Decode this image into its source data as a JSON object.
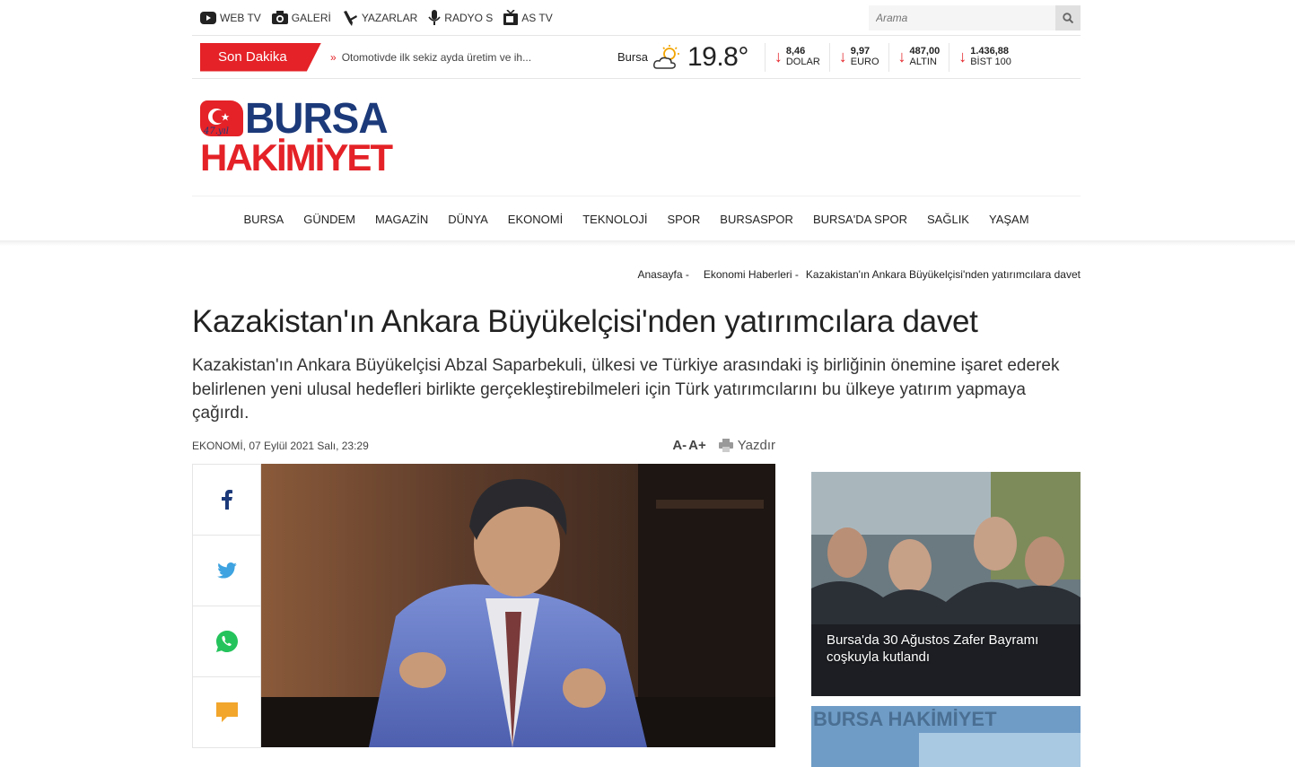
{
  "topbar": {
    "links": [
      {
        "label": "WEB TV",
        "icon": "youtube-icon"
      },
      {
        "label": "GALERİ",
        "icon": "camera-icon"
      },
      {
        "label": "YAZARLAR",
        "icon": "pen-icon"
      },
      {
        "label": "RADYO S",
        "icon": "microphone-icon"
      },
      {
        "label": "AS TV",
        "icon": "tv-icon"
      }
    ],
    "search_placeholder": "Arama"
  },
  "breaking": {
    "label": "Son Dakika",
    "headline": "Otomotivde ilk sekiz ayda üretim ve ih..."
  },
  "weather": {
    "city": "Bursa",
    "temp": "19.8°",
    "icon": "partly-cloudy-icon"
  },
  "rates": [
    {
      "value": "8,46",
      "label": "DOLAR",
      "trend": "down"
    },
    {
      "value": "9,97",
      "label": "EURO",
      "trend": "down"
    },
    {
      "value": "487,00",
      "label": "ALTIN",
      "trend": "down"
    },
    {
      "value": "1.436,88",
      "label": "BİST 100",
      "trend": "down"
    }
  ],
  "logo": {
    "line1": "BURSA",
    "line2": "HAKİMİYET",
    "emblem": "47.yıl"
  },
  "nav": [
    "BURSA",
    "GÜNDEM",
    "MAGAZİN",
    "DÜNYA",
    "EKONOMİ",
    "TEKNOLOJİ",
    "SPOR",
    "BURSASPOR",
    "BURSA'DA SPOR",
    "SAĞLIK",
    "YAŞAM"
  ],
  "breadcrumb": [
    "Anasayfa",
    "Ekonomi Haberleri",
    "Kazakistan'ın Ankara Büyükelçisi'nden yatırımcılara davet"
  ],
  "article": {
    "title": "Kazakistan'ın Ankara Büyükelçisi'nden yatırımcılara davet",
    "spot": "Kazakistan'ın Ankara Büyükelçisi Abzal Saparbekuli, ülkesi ve Türkiye arasındaki iş birliğinin önemine işaret ederek belirlenen yeni ulusal hedefleri birlikte gerçekleştirebilmeleri için Türk yatırımcılarını bu ülkeye yatırım yapmaya çağırdı.",
    "category": "EKONOMİ",
    "date": ", 07 Eylül 2021 Salı, 23:29",
    "font_down": "A-",
    "font_up": "A+",
    "print": "Yazdır"
  },
  "share": [
    "facebook-icon",
    "twitter-icon",
    "whatsapp-icon",
    "comment-icon"
  ],
  "sidebar": {
    "card1_title": "Bursa'da 30 Ağustos Zafer Bayramı coşkuyla kutlandı",
    "card2_watermark": "BURSA HAKİMİYET"
  },
  "colors": {
    "brand_red": "#e42227",
    "brand_blue": "#1c3a7a"
  }
}
